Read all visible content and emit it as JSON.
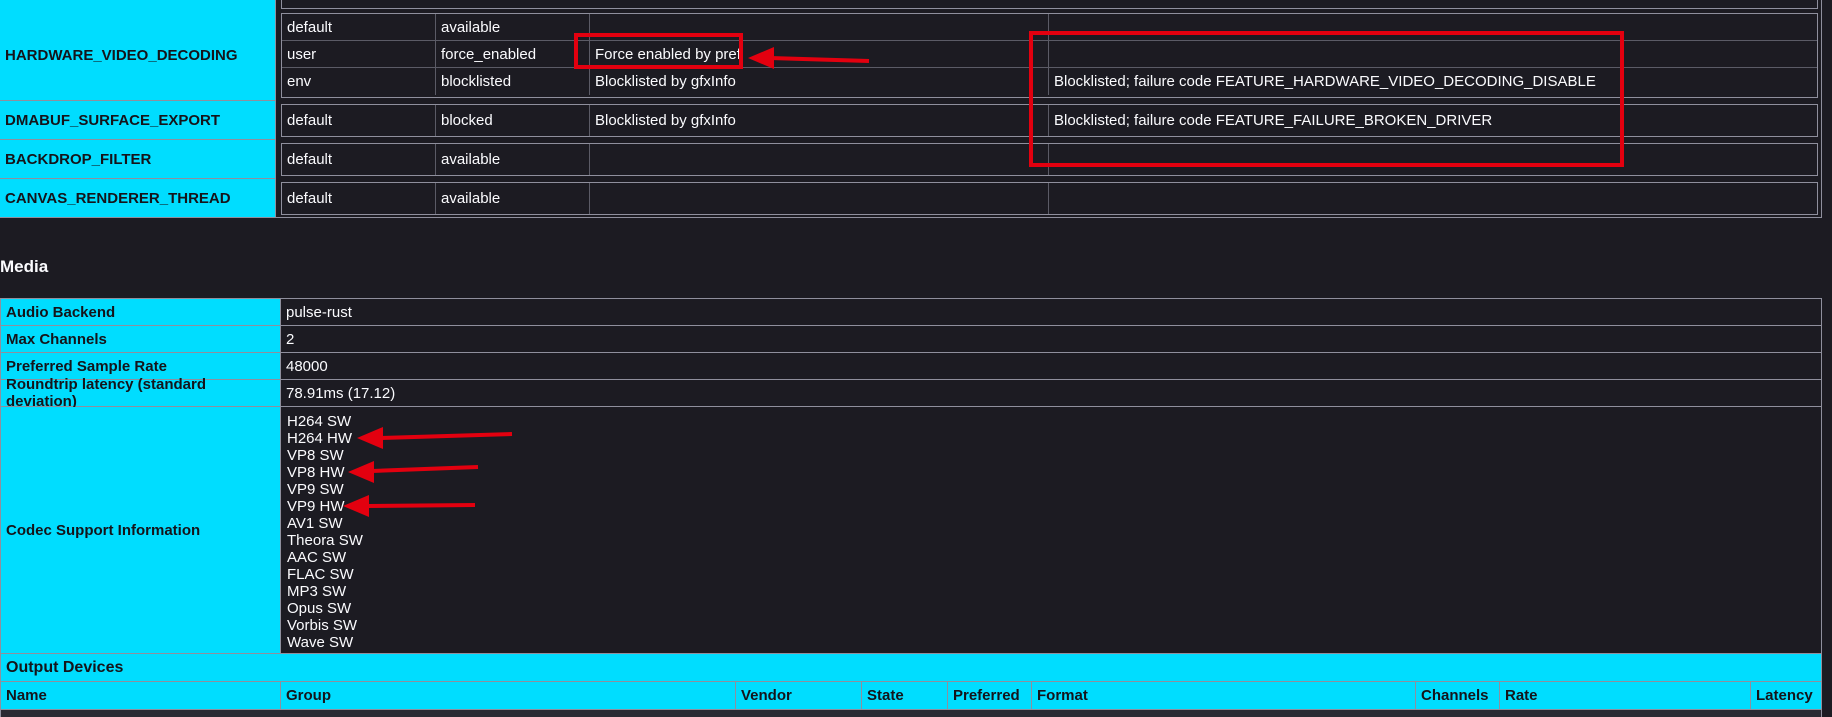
{
  "features": [
    {
      "name": "HARDWARE_VIDEO_DECODING",
      "rows": [
        {
          "type": "default",
          "status": "available",
          "message": "",
          "failure": ""
        },
        {
          "type": "user",
          "status": "force_enabled",
          "message": "Force enabled by pref",
          "failure": ""
        },
        {
          "type": "env",
          "status": "blocklisted",
          "message": "Blocklisted by gfxInfo",
          "failure": "Blocklisted; failure code FEATURE_HARDWARE_VIDEO_DECODING_DISABLE"
        }
      ]
    },
    {
      "name": "DMABUF_SURFACE_EXPORT",
      "rows": [
        {
          "type": "default",
          "status": "blocked",
          "message": "Blocklisted by gfxInfo",
          "failure": "Blocklisted; failure code FEATURE_FAILURE_BROKEN_DRIVER"
        }
      ]
    },
    {
      "name": "BACKDROP_FILTER",
      "rows": [
        {
          "type": "default",
          "status": "available",
          "message": "",
          "failure": ""
        }
      ]
    },
    {
      "name": "CANVAS_RENDERER_THREAD",
      "rows": [
        {
          "type": "default",
          "status": "available",
          "message": "",
          "failure": ""
        }
      ]
    }
  ],
  "media": {
    "title": "Media",
    "audio_backend": {
      "label": "Audio Backend",
      "value": "pulse-rust"
    },
    "max_channels": {
      "label": "Max Channels",
      "value": "2"
    },
    "sample_rate": {
      "label": "Preferred Sample Rate",
      "value": "48000"
    },
    "latency": {
      "label": "Roundtrip latency (standard deviation)",
      "value": "78.91ms (17.12)"
    },
    "codecs": {
      "label": "Codec Support Information",
      "items": [
        "H264 SW",
        "H264 HW",
        "VP8 SW",
        "VP8 HW",
        "VP9 SW",
        "VP9 HW",
        "AV1 SW",
        "Theora SW",
        "AAC SW",
        "FLAC SW",
        "MP3 SW",
        "Opus SW",
        "Vorbis SW",
        "Wave SW"
      ]
    },
    "output_devices": {
      "title": "Output Devices",
      "columns": [
        "Name",
        "Group",
        "Vendor",
        "State",
        "Preferred",
        "Format",
        "Channels",
        "Rate",
        "Latency"
      ]
    }
  },
  "colors": {
    "background": "#1c1b22",
    "header_cyan": "#00ddff",
    "annotation_red": "#e3000f"
  }
}
